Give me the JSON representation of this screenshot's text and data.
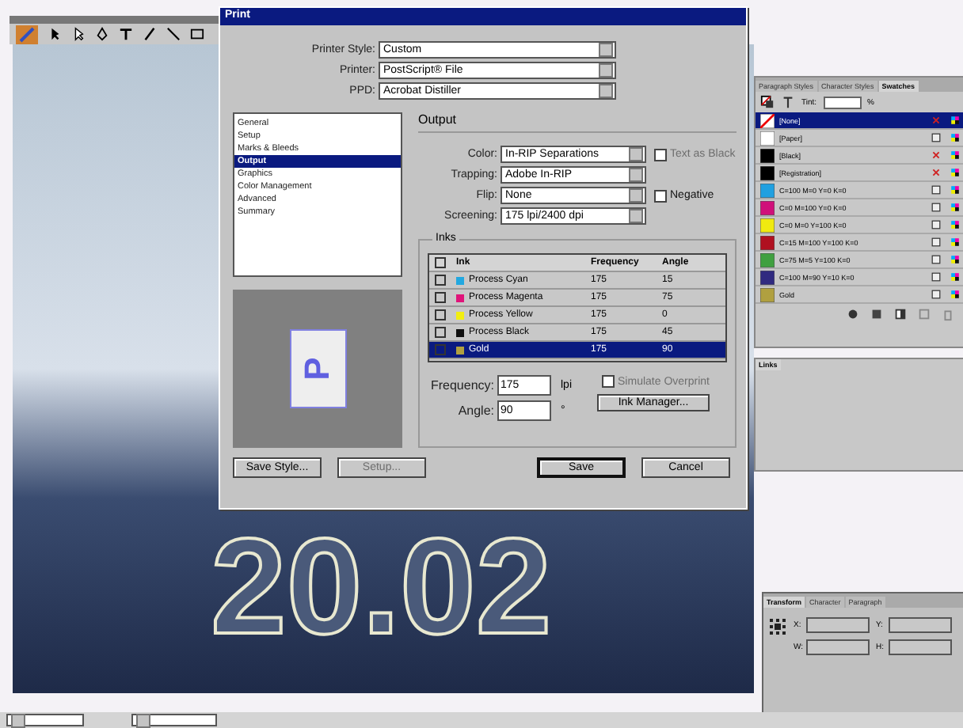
{
  "document": {
    "headline": "20.02"
  },
  "print_dialog": {
    "title": "Print",
    "fields": [
      {
        "label": "Printer Style:",
        "value": "Custom"
      },
      {
        "label": "Printer:",
        "value": "PostScript® File"
      },
      {
        "label": "PPD:",
        "value": "Acrobat Distiller"
      }
    ],
    "categories": [
      {
        "label": "General",
        "selected": false
      },
      {
        "label": "Setup",
        "selected": false
      },
      {
        "label": "Marks & Bleeds",
        "selected": false
      },
      {
        "label": "Output",
        "selected": true
      },
      {
        "label": "Graphics",
        "selected": false
      },
      {
        "label": "Color Management",
        "selected": false
      },
      {
        "label": "Advanced",
        "selected": false
      },
      {
        "label": "Summary",
        "selected": false
      }
    ],
    "preview_letter": "P",
    "section_title": "Output",
    "output_fields": [
      {
        "label": "Color:",
        "value": "In-RIP Separations",
        "option": {
          "label": "Text as Black",
          "checked": false,
          "disabled": true
        }
      },
      {
        "label": "Trapping:",
        "value": "Adobe In-RIP"
      },
      {
        "label": "Flip:",
        "value": "None",
        "option": {
          "label": "Negative",
          "checked": false,
          "disabled": false
        }
      },
      {
        "label": "Screening:",
        "value": "175 lpi/2400 dpi"
      }
    ],
    "inks": {
      "title": "Inks",
      "columns": [
        "Ink",
        "Frequency",
        "Angle"
      ],
      "rows": [
        {
          "name": "Process Cyan",
          "color": "#22a8e0",
          "frequency": "175",
          "angle": "15",
          "selected": false
        },
        {
          "name": "Process Magenta",
          "color": "#e0147a",
          "frequency": "175",
          "angle": "75",
          "selected": false
        },
        {
          "name": "Process Yellow",
          "color": "#f2ee10",
          "frequency": "175",
          "angle": "0",
          "selected": false
        },
        {
          "name": "Process Black",
          "color": "#101010",
          "frequency": "175",
          "angle": "45",
          "selected": false
        },
        {
          "name": "Gold",
          "color": "#b0a040",
          "frequency": "175",
          "angle": "90",
          "selected": true
        }
      ]
    },
    "frequency": {
      "label": "Frequency:",
      "value": "175",
      "unit": "lpi"
    },
    "angle": {
      "label": "Angle:",
      "value": "90",
      "unit": "°"
    },
    "simulate_overprint": {
      "label": "Simulate Overprint",
      "checked": false,
      "disabled": true
    },
    "ink_manager": "Ink Manager...",
    "buttons": [
      {
        "label": "Save Style...",
        "disabled": false,
        "default": false
      },
      {
        "label": "Setup...",
        "disabled": true,
        "default": false
      },
      {
        "label": "Save",
        "disabled": false,
        "default": true
      },
      {
        "label": "Cancel",
        "disabled": false,
        "default": false
      }
    ]
  },
  "swatches_panel": {
    "tabs": [
      {
        "label": "Paragraph Styles",
        "selected": false
      },
      {
        "label": "Character Styles",
        "selected": false
      },
      {
        "label": "Swatches",
        "selected": true
      }
    ],
    "tint": {
      "label": "Tint:",
      "unit": "%"
    },
    "swatches": [
      {
        "name": "[None]",
        "kind": "none",
        "color": "#ffffff",
        "editable": false,
        "selected": true
      },
      {
        "name": "[Paper]",
        "kind": "color",
        "color": "#ffffff",
        "editable": true,
        "selected": false
      },
      {
        "name": "[Black]",
        "kind": "color",
        "color": "#000000",
        "editable": false,
        "selected": false
      },
      {
        "name": "[Registration]",
        "kind": "color",
        "color": "#000000",
        "editable": false,
        "selected": false
      },
      {
        "name": "C=100 M=0 Y=0 K=0",
        "kind": "color",
        "color": "#20a0e0",
        "editable": true,
        "selected": false
      },
      {
        "name": "C=0 M=100 Y=0 K=0",
        "kind": "color",
        "color": "#d0107a",
        "editable": true,
        "selected": false
      },
      {
        "name": "C=0 M=0 Y=100 K=0",
        "kind": "color",
        "color": "#f0ea10",
        "editable": true,
        "selected": false
      },
      {
        "name": "C=15 M=100 Y=100 K=0",
        "kind": "color",
        "color": "#b01020",
        "editable": true,
        "selected": false
      },
      {
        "name": "C=75 M=5 Y=100 K=0",
        "kind": "color",
        "color": "#40a040",
        "editable": true,
        "selected": false
      },
      {
        "name": "C=100 M=90 Y=10 K=0",
        "kind": "color",
        "color": "#302a80",
        "editable": true,
        "selected": false
      },
      {
        "name": "Gold",
        "kind": "color",
        "color": "#b0a040",
        "editable": true,
        "selected": false
      }
    ]
  },
  "links_panel": {
    "title": "Links"
  },
  "transform_panel": {
    "tabs": [
      {
        "label": "Transform",
        "selected": true
      },
      {
        "label": "Character",
        "selected": false
      },
      {
        "label": "Paragraph",
        "selected": false
      }
    ],
    "labels": [
      "X:",
      "Y:",
      "W:",
      "H:"
    ]
  }
}
